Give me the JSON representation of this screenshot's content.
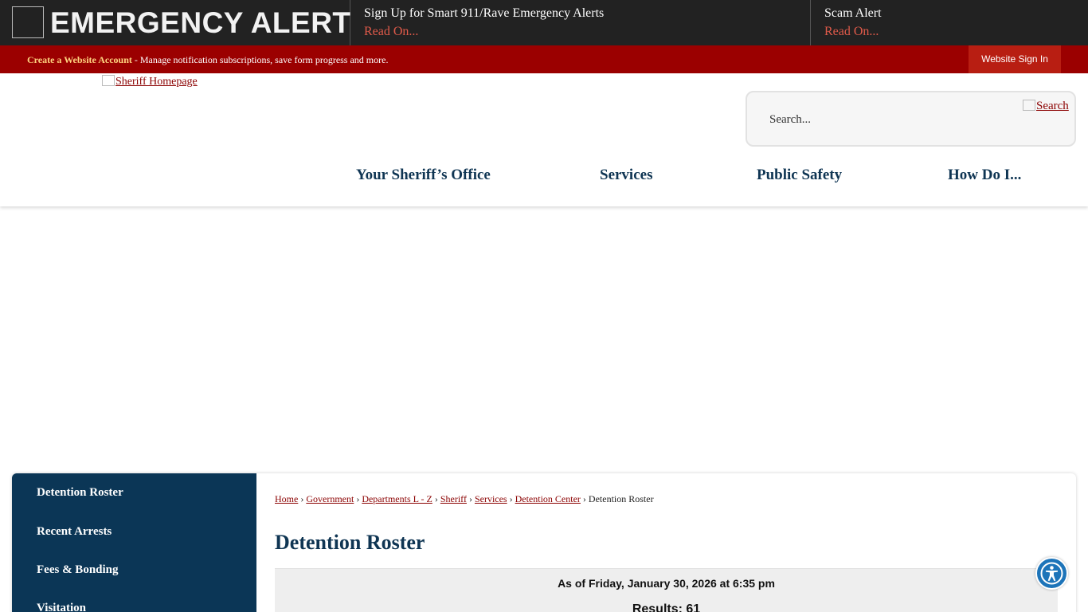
{
  "alert": {
    "title": "EMERGENCY ALERT",
    "items": [
      {
        "title": "Sign Up for Smart 911/Rave Emergency Alerts",
        "more": "Read On..."
      },
      {
        "title": "Scam Alert",
        "more": "Read On..."
      }
    ]
  },
  "account": {
    "create_label": "Create a Website Account",
    "description": " - Manage notification subscriptions, save form progress and more.",
    "signin_label": "Website Sign In"
  },
  "header": {
    "logo_alt": "Sheriff Homepage",
    "search_placeholder": "Search...",
    "search_button": "Search",
    "nav": [
      "Your Sheriff’s Office",
      "Services",
      "Public Safety",
      "How Do I..."
    ]
  },
  "sidebar": {
    "items": [
      "Detention Roster",
      "Recent Arrests",
      "Fees & Bonding",
      "Visitation"
    ]
  },
  "breadcrumb": {
    "links": [
      "Home",
      "Government",
      "Departments L - Z",
      "Sheriff",
      "Services",
      "Detention Center"
    ],
    "separator": " › ",
    "current": "Detention Roster"
  },
  "page": {
    "title": "Detention Roster",
    "as_of": "As of Friday, January 30, 2026 at 6:35 pm",
    "results": "Results: 61"
  },
  "colors": {
    "alert_bg": "#222222",
    "account_bg": "#9b0000",
    "nav_text": "#0f3553",
    "sidebar_bg": "#0b3656",
    "accent_link": "#8b0000"
  }
}
